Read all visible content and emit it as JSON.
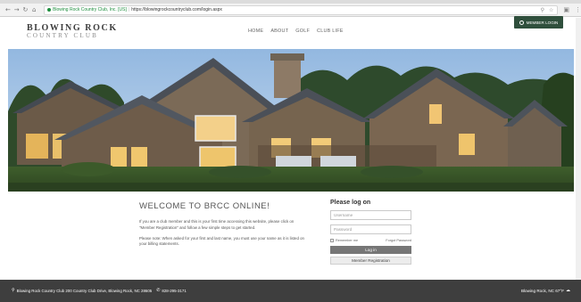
{
  "browser": {
    "secure_label": "Blowing Rock Country Club, Inc. [US]",
    "url": "https://blowingrockcountryclub.com/login.aspx",
    "back_icon": "arrow-left-icon",
    "forward_icon": "arrow-right-icon",
    "reload_icon": "reload-icon",
    "home_icon": "home-icon"
  },
  "header": {
    "logo_main": "BLOWING ROCK",
    "logo_sub": "COUNTRY CLUB",
    "nav": [
      {
        "label": "HOME"
      },
      {
        "label": "ABOUT"
      },
      {
        "label": "GOLF"
      },
      {
        "label": "CLUB LIFE"
      }
    ],
    "member_login_label": "MEMBER LOGIN",
    "member_login_color": "#2f4f3c"
  },
  "welcome": {
    "title": "WELCOME TO BRCC ONLINE!",
    "paragraph1": "If you are a club member and this is your first time accessing this website, please click on \"Member Registration\" and follow a few simple steps to get started.",
    "paragraph2": "Please note: When asked for your first and last name, you must use your name as it is listed on your billing statements."
  },
  "login": {
    "title": "Please log on",
    "username_placeholder": "Username",
    "password_placeholder": "Password",
    "remember_label": "Remember me",
    "forgot_label": "Forgot Password",
    "login_button": "Log in",
    "register_button": "Member Registration"
  },
  "footer": {
    "address": "Blowing Rock Country Club 200 Country Club Drive, Blowing Rock, NC 28605",
    "phone": "828-295-3171",
    "weather": "Blowing Rock, NC 67°F",
    "background_color": "#3e3e3e"
  }
}
